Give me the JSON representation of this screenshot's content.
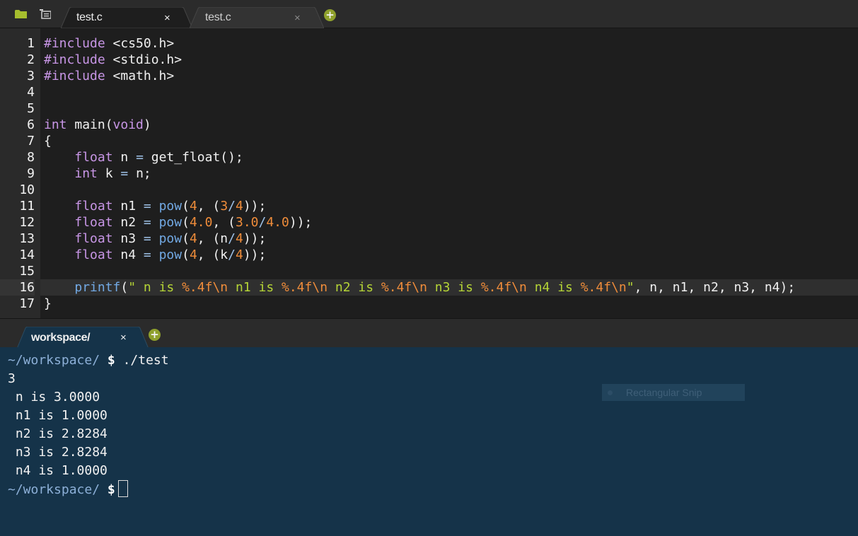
{
  "toolbar": {
    "folder_icon": "folder-icon",
    "outline_icon": "outline-icon"
  },
  "tabs": [
    {
      "label": "test.c",
      "close": "×",
      "active": true
    },
    {
      "label": "test.c",
      "close": "×",
      "active": false
    }
  ],
  "new_tab": "+",
  "editor": {
    "line_numbers": [
      "1",
      "2",
      "3",
      "4",
      "5",
      "6",
      "7",
      "8",
      "9",
      "10",
      "11",
      "12",
      "13",
      "14",
      "15",
      "16",
      "17"
    ],
    "active_line": 16,
    "lines": [
      "#include <cs50.h>",
      "#include <stdio.h>",
      "#include <math.h>",
      "",
      "",
      "int main(void)",
      "{",
      "    float n = get_float();",
      "    int k = n;",
      "",
      "    float n1 = pow(4, (3/4));",
      "    float n2 = pow(4.0, (3.0/4.0));",
      "    float n3 = pow(4, (n/4));",
      "    float n4 = pow(4, (k/4));",
      "",
      "    printf(\" n is %.4f\\n n1 is %.4f\\n n2 is %.4f\\n n3 is %.4f\\n n4 is %.4f\\n\", n, n1, n2, n3, n4);",
      "}"
    ]
  },
  "terminal_tab": {
    "label": "workspace/",
    "close": "×"
  },
  "terminal_new_tab": "+",
  "terminal": {
    "prompt_path": "~/workspace/",
    "prompt_symbol": "$",
    "command": "./test",
    "output": [
      "3",
      " n is 3.0000",
      " n1 is 1.0000",
      " n2 is 2.8284",
      " n3 is 2.8284",
      " n4 is 1.0000"
    ]
  },
  "overlay": {
    "label": "Rectangular Snip"
  },
  "colors": {
    "keyword": "#c896e6",
    "function": "#72a9e4",
    "number": "#ef8c3a",
    "string": "#b5d436",
    "terminal_bg": "#153349",
    "accent_plus": "#8fa02c"
  }
}
